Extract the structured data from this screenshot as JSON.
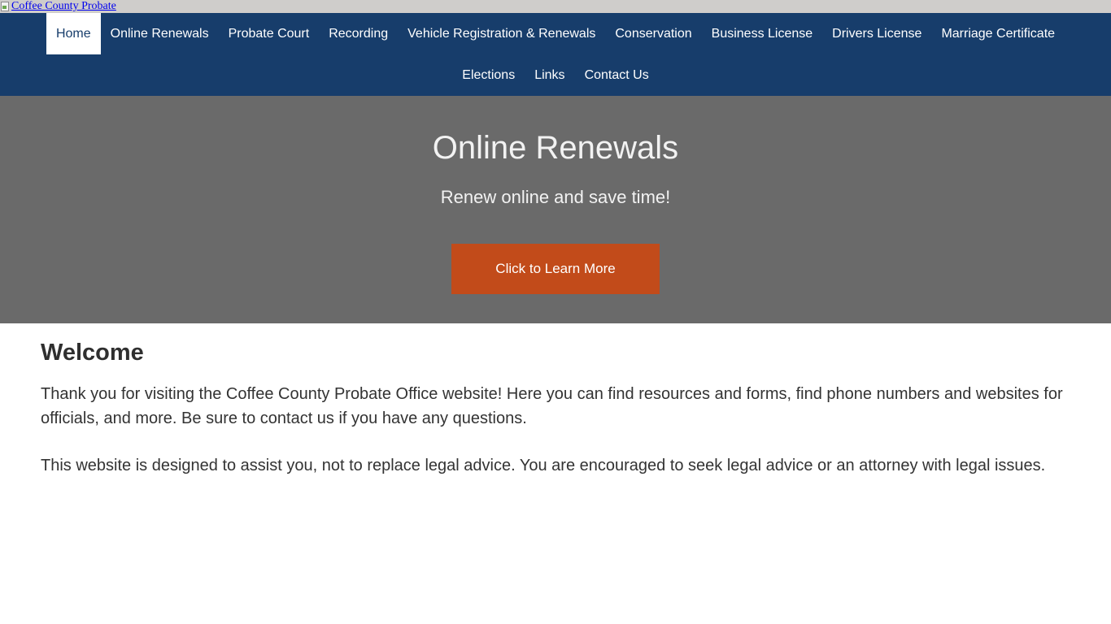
{
  "header": {
    "logo_alt": "Coffee County Probate",
    "logo_icon": "broken-image-icon"
  },
  "nav": {
    "row1": [
      {
        "label": "Home",
        "active": true
      },
      {
        "label": "Online Renewals"
      },
      {
        "label": "Probate Court"
      },
      {
        "label": "Recording"
      },
      {
        "label": "Vehicle Registration & Renewals"
      },
      {
        "label": "Conservation"
      },
      {
        "label": "Business License"
      },
      {
        "label": "Drivers License"
      },
      {
        "label": "Marriage Certificate"
      }
    ],
    "row2": [
      {
        "label": "Elections"
      },
      {
        "label": "Links"
      },
      {
        "label": "Contact Us"
      }
    ]
  },
  "hero": {
    "title": "Online Renewals",
    "subtitle": "Renew online and save time!",
    "button_label": "Click to Learn More"
  },
  "content": {
    "heading": "Welcome",
    "paragraph1": "Thank you for visiting the Coffee County Probate Office website! Here you can find resources and forms, find phone numbers and websites for officials, and more. Be sure to contact us if you have any questions.",
    "paragraph2": "This website is designed to assist you, not to replace legal advice. You are encouraged to seek legal advice or an attorney with legal issues."
  },
  "colors": {
    "topbar": "#cfcdcb",
    "nav_bg": "#173d6b",
    "hero_bg": "#6a6a6a",
    "button_bg": "#c24b1a"
  }
}
